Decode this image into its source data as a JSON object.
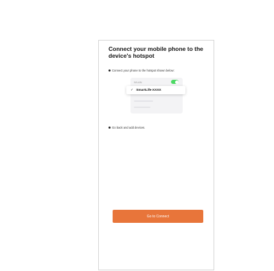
{
  "page": {
    "title": "Connect your mobile phone to the device's hotspot",
    "step1": "Connect your phone to the hotspot shown below:",
    "step2": "Go back and add devices."
  },
  "illustration": {
    "wlan_label": "WLAN",
    "toggle_on": true,
    "toggle_color": "#4cd964",
    "network_name": "SmartLife-XXXX",
    "check_icon": "checkmark-icon"
  },
  "actions": {
    "connect_label": "Go to Connect",
    "button_color": "#e8753a"
  }
}
